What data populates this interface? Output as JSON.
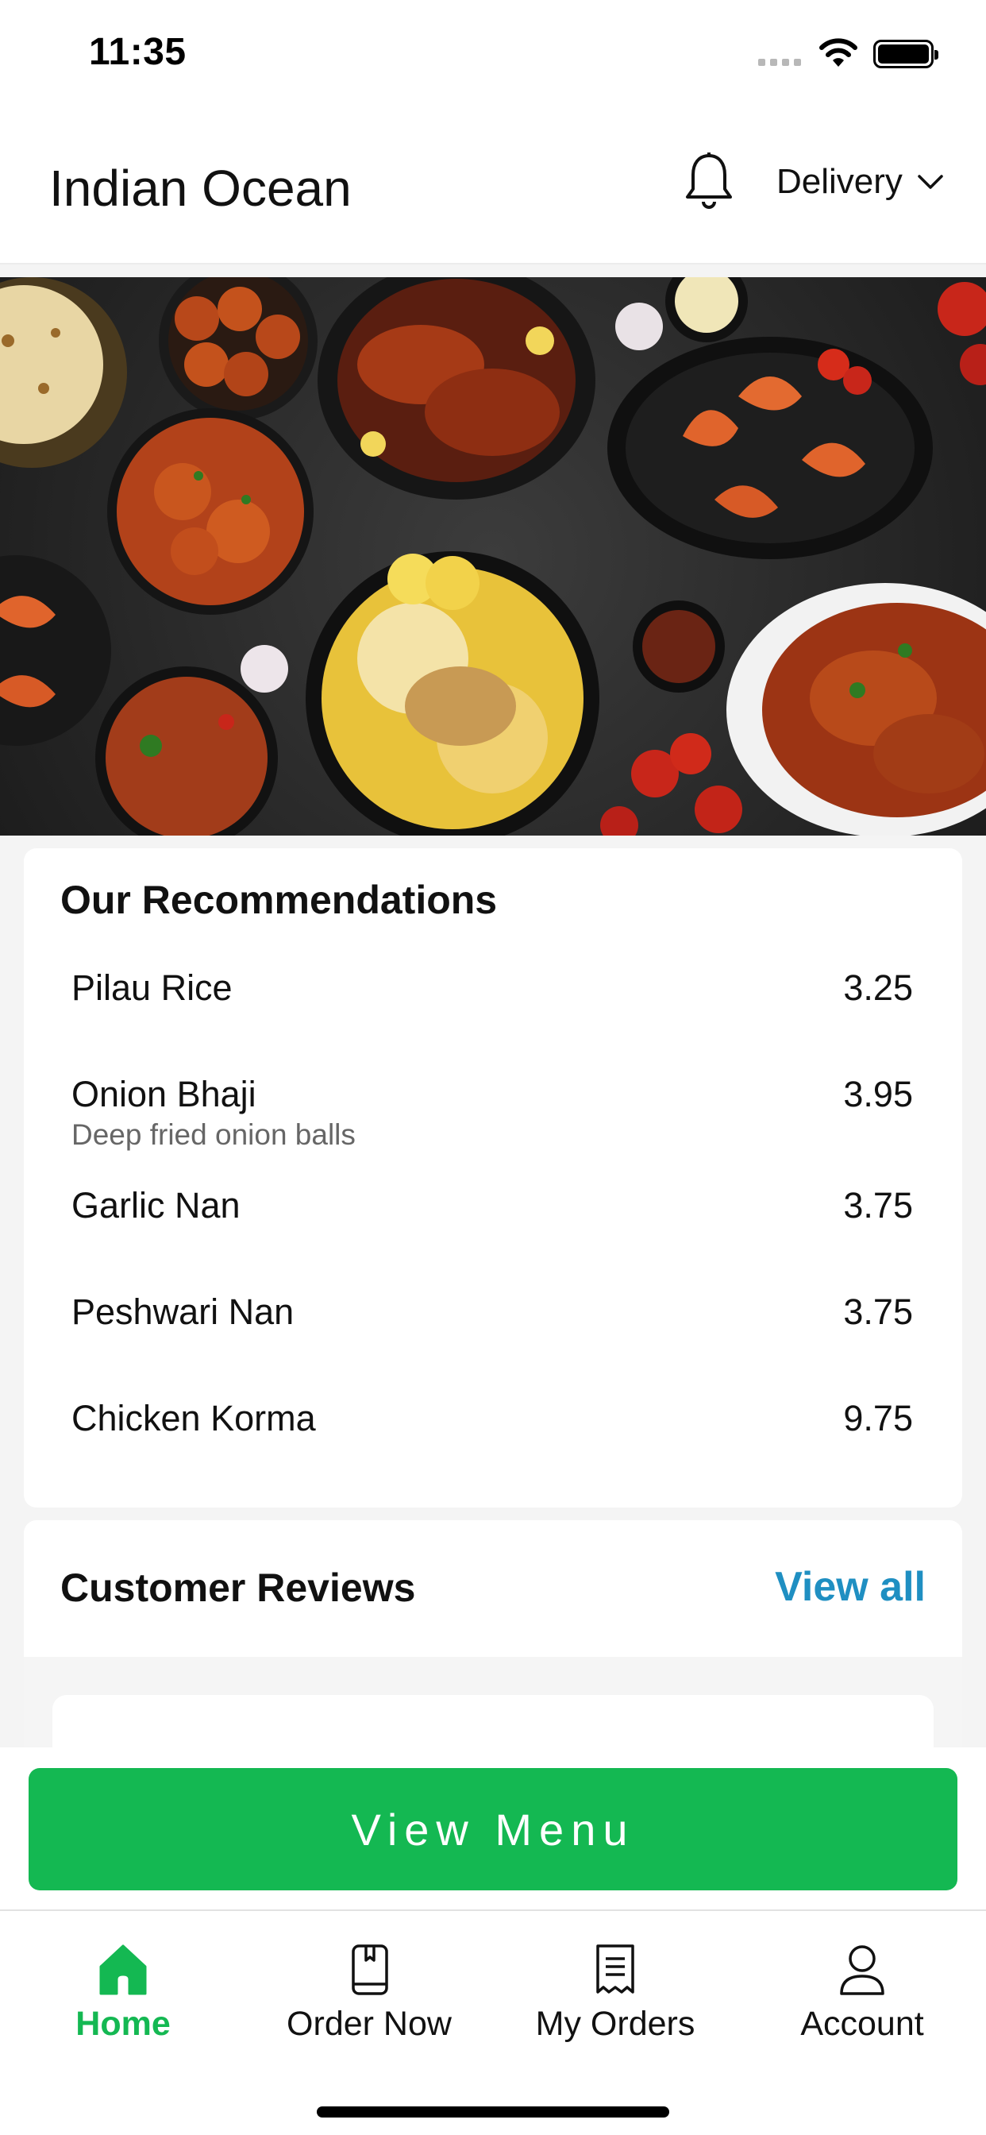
{
  "status_bar": {
    "time": "11:35"
  },
  "header": {
    "restaurant_name": "Indian Ocean",
    "notification_icon": "bell-icon",
    "order_mode": "Delivery"
  },
  "recommendations": {
    "title": "Our Recommendations",
    "items": [
      {
        "name": "Pilau Rice",
        "description": "",
        "price": "3.25"
      },
      {
        "name": "Onion Bhaji",
        "description": "Deep fried onion balls",
        "price": "3.95"
      },
      {
        "name": "Garlic Nan",
        "description": "",
        "price": "3.75"
      },
      {
        "name": "Peshwari Nan",
        "description": "",
        "price": "3.75"
      },
      {
        "name": "Chicken Korma",
        "description": "",
        "price": "9.75"
      }
    ]
  },
  "reviews": {
    "title": "Customer Reviews",
    "view_all_label": "View all"
  },
  "cta": {
    "view_menu_label": "View Menu"
  },
  "tab_bar": {
    "tabs": [
      {
        "label": "Home",
        "icon": "home-icon",
        "active": true
      },
      {
        "label": "Order Now",
        "icon": "order-book-icon",
        "active": false
      },
      {
        "label": "My Orders",
        "icon": "receipt-icon",
        "active": false
      },
      {
        "label": "Account",
        "icon": "user-icon",
        "active": false
      }
    ]
  },
  "colors": {
    "accent_green": "#14b852",
    "link_blue": "#1f8fc2"
  }
}
